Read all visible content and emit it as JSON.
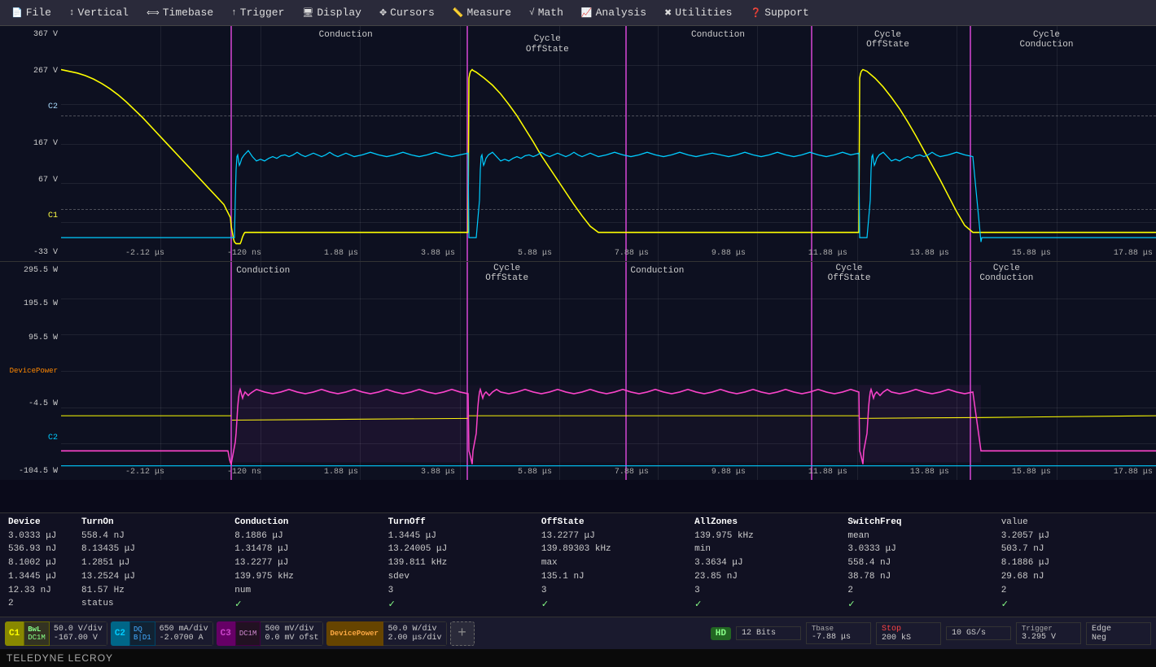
{
  "menubar": {
    "items": [
      {
        "label": "File",
        "icon": "📄"
      },
      {
        "label": "Vertical",
        "icon": "↕"
      },
      {
        "label": "Timebase",
        "icon": "⟺"
      },
      {
        "label": "Trigger",
        "icon": "↑"
      },
      {
        "label": "Display",
        "icon": "🖥"
      },
      {
        "label": "Cursors",
        "icon": "✥"
      },
      {
        "label": "Measure",
        "icon": "📏"
      },
      {
        "label": "Math",
        "icon": "√"
      },
      {
        "label": "Analysis",
        "icon": "📈"
      },
      {
        "label": "Utilities",
        "icon": "✖"
      },
      {
        "label": "Support",
        "icon": "❓"
      }
    ]
  },
  "top_panel": {
    "y_labels": [
      "367 V",
      "267 V",
      "167 V",
      "67 V",
      "-33 V"
    ],
    "time_labels": [
      "-2.12 μs",
      "-120 ns",
      "1.88 μs",
      "3.88 μs",
      "5.88 μs",
      "7.88 μs",
      "9.88 μs",
      "11.88 μs",
      "13.88 μs",
      "15.88 μs",
      "17.88 μs"
    ],
    "zones": [
      {
        "label": "Conduction",
        "pos_pct": 22
      },
      {
        "label": "Cycle\nOffState",
        "pos_pct": 40
      },
      {
        "label": "Conduction",
        "pos_pct": 57
      },
      {
        "label": "Cycle\nOffState",
        "pos_pct": 72
      },
      {
        "label": "Cycle\nConduction",
        "pos_pct": 87
      }
    ]
  },
  "bottom_panel": {
    "y_labels": [
      "295.5 W",
      "195.5 W",
      "95.5 W",
      "-4.5 W",
      "-104.5 W"
    ],
    "time_labels": [
      "-2.12 μs",
      "-120 ns",
      "1.88 μs",
      "3.88 μs",
      "5.88 μs",
      "7.88 μs",
      "9.88 μs",
      "11.88 μs",
      "13.88 μs",
      "15.88 μs",
      "17.88 μs"
    ],
    "zone_label_device_power": "DevicePower",
    "c2_label": "C2"
  },
  "stats": {
    "col_headers": [
      "Device",
      "TurnOn",
      "Conduction",
      "TurnOff",
      "OffState",
      "AllZones",
      "SwitchFreq"
    ],
    "rows": [
      {
        "label": "value",
        "values": [
          "",
          "3.0333 μJ",
          "558.4 nJ",
          "8.1886 μJ",
          "1.3445 μJ",
          "13.2277 μJ",
          "139.975 kHz"
        ]
      },
      {
        "label": "mean",
        "values": [
          "",
          "3.2057 μJ",
          "536.93 nJ",
          "8.13435 μJ",
          "1.31478 μJ",
          "13.24005 μJ",
          "139.89303 kHz"
        ]
      },
      {
        "label": "min",
        "values": [
          "",
          "3.0333 μJ",
          "503.7 nJ",
          "8.1002 μJ",
          "1.2851 μJ",
          "13.2277 μJ",
          "139.811 kHz"
        ]
      },
      {
        "label": "max",
        "values": [
          "",
          "3.3634 μJ",
          "558.4 nJ",
          "8.1886 μJ",
          "1.3445 μJ",
          "13.2524 μJ",
          "139.975 kHz"
        ]
      },
      {
        "label": "sdev",
        "values": [
          "",
          "135.1 nJ",
          "23.85 nJ",
          "38.78 nJ",
          "29.68 nJ",
          "12.33 nJ",
          "81.57 Hz"
        ]
      },
      {
        "label": "num",
        "values": [
          "",
          "3",
          "3",
          "3",
          "2",
          "2",
          "2"
        ]
      },
      {
        "label": "status",
        "values": [
          "",
          "✓",
          "✓",
          "✓",
          "✓",
          "✓",
          "✓"
        ]
      }
    ]
  },
  "channels": [
    {
      "id": "C1",
      "color": "#ffff00",
      "badge": "BwL DC1M",
      "info1": "50.0 V/div",
      "info2": "-167.00 V"
    },
    {
      "id": "C2",
      "color": "#00ccff",
      "badge": "DQ B D1",
      "info1": "650 mA/div",
      "info2": "-2.0700 A"
    },
    {
      "id": "C3",
      "color": "#cc44cc",
      "badge": "DC1M",
      "info1": "500 mV/div",
      "info2": "0.0 mV ofst"
    },
    {
      "id": "DevicePower",
      "color": "#ff8800",
      "badge": "",
      "info1": "50.0 W/div",
      "info2": "2.00 μs/div"
    }
  ],
  "right_info": {
    "hd": "HD",
    "bits": "12 Bits",
    "tbase_label": "Tbase",
    "tbase_val": "-7.88 μs",
    "stop_label": "Stop",
    "sample_rate": "200 kS",
    "sample_rate2": "10 GS/s",
    "trigger_label": "Trigger",
    "trigger_val": "3.295 V",
    "edge_label": "Edge",
    "neg_label": "Neg"
  },
  "teledyne": "TELEDYNE LECROY"
}
